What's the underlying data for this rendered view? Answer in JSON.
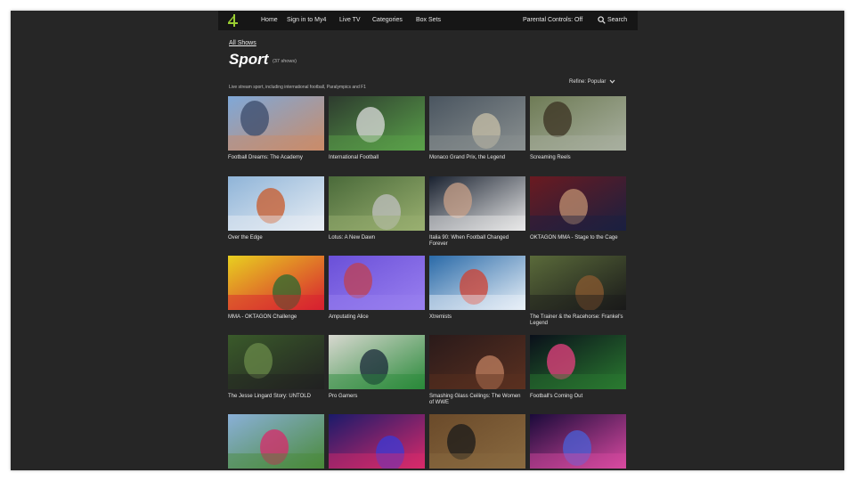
{
  "nav": {
    "logo_label": "4",
    "links": [
      "Home",
      "Sign in to My4",
      "Live TV",
      "Categories",
      "Box Sets"
    ],
    "parental": "Parental Controls: Off",
    "search": "Search"
  },
  "page": {
    "breadcrumb": "All Shows",
    "title": "Sport",
    "count": "(37 shows)",
    "description": "Live stream sport, including international football, Paralympics and F1",
    "refine": "Refine: Popular"
  },
  "shows": [
    {
      "title": "Football Dreams: The Academy",
      "colors": [
        "#7fa8d8",
        "#c98c6a",
        "#3a4a6a"
      ]
    },
    {
      "title": "International Football",
      "colors": [
        "#2d3b2e",
        "#5aa14a",
        "#dcdcdc"
      ]
    },
    {
      "title": "Monaco Grand Prix, the Legend",
      "colors": [
        "#4a5560",
        "#8a9090",
        "#c8c0a8"
      ]
    },
    {
      "title": "Screaming Reels",
      "colors": [
        "#6e7b55",
        "#a9b0a0",
        "#3a3020"
      ]
    },
    {
      "title": "Over the Edge",
      "colors": [
        "#8fb4d8",
        "#e8eef4",
        "#c85a2a"
      ]
    },
    {
      "title": "Lotus: A New Dawn",
      "colors": [
        "#4a6a3a",
        "#9ab070",
        "#c0c0c0"
      ]
    },
    {
      "title": "Italia 90: When Football Changed Forever",
      "colors": [
        "#1a2230",
        "#e8e8e8",
        "#c8a088"
      ]
    },
    {
      "title": "OKTAGON MMA - Stage to the Cage",
      "colors": [
        "#6a1a20",
        "#1a2040",
        "#c09070"
      ]
    },
    {
      "title": "MMA - OKTAGON Challenge",
      "colors": [
        "#e8d020",
        "#d82030",
        "#2a6a30"
      ]
    },
    {
      "title": "Amputating Alice",
      "colors": [
        "#6a50d8",
        "#9a80f0",
        "#c04050"
      ]
    },
    {
      "title": "Xtremists",
      "colors": [
        "#2a6aa8",
        "#e8f0f8",
        "#d04030"
      ]
    },
    {
      "title": "The Trainer & the Racehorse: Frankel's Legend",
      "colors": [
        "#5a6a3a",
        "#1a1a1a",
        "#8a5a30"
      ]
    },
    {
      "title": "The Jesse Lingard Story: UNTOLD",
      "colors": [
        "#3a5a2a",
        "#222222",
        "#6a8a4a"
      ]
    },
    {
      "title": "Pro Gamers",
      "colors": [
        "#d8d8d0",
        "#2a8a3a",
        "#1a2a3a"
      ]
    },
    {
      "title": "Smashing Glass Ceilings: The Women of WWE",
      "colors": [
        "#2a1a1a",
        "#5a3020",
        "#c08060"
      ]
    },
    {
      "title": "Football's Coming Out",
      "colors": [
        "#0a0f1a",
        "#2a7a30",
        "#e84080"
      ]
    },
    {
      "title": "",
      "colors": [
        "#8ab0d8",
        "#4a8a3a",
        "#d82a6a"
      ]
    },
    {
      "title": "",
      "colors": [
        "#1a1a6a",
        "#d82a6a",
        "#3a3ad8"
      ]
    },
    {
      "title": "",
      "colors": [
        "#6a4a2a",
        "#8a6a40",
        "#1a1a1a"
      ]
    },
    {
      "title": "",
      "colors": [
        "#1a0a3a",
        "#d84aa0",
        "#4a60d8"
      ]
    }
  ],
  "colors": {
    "background": "#262626",
    "nav": "#161616",
    "text": "#e6e6e6",
    "logo": "#9acd32"
  },
  "icons": [
    "channel4-logo-icon",
    "search-icon",
    "chevron-down-icon"
  ]
}
